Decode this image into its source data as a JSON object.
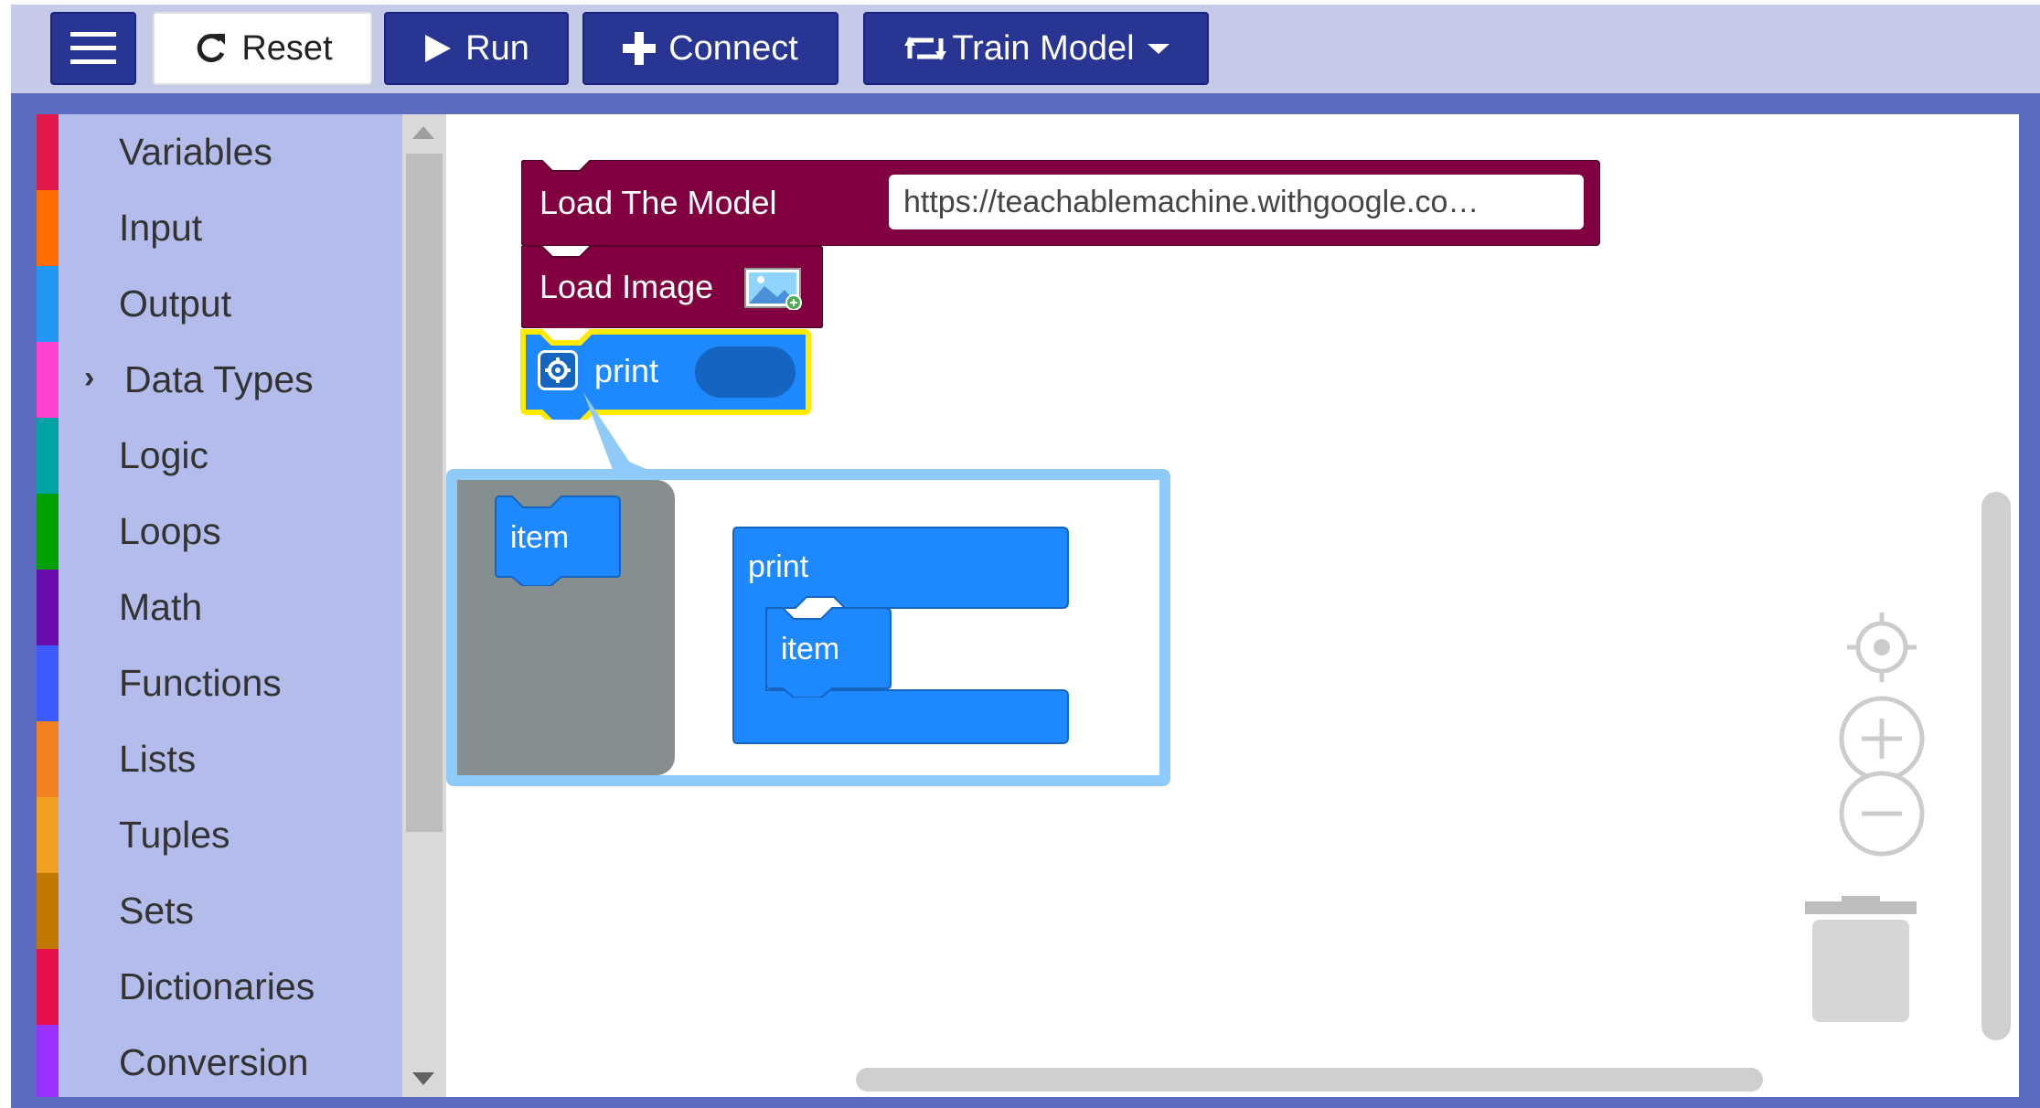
{
  "toolbar": {
    "reset_label": "Reset",
    "run_label": "Run",
    "connect_label": "Connect",
    "train_label": "Train Model"
  },
  "toolbox": {
    "categories": [
      {
        "label": "Variables",
        "color": "#e0194a"
      },
      {
        "label": "Input",
        "color": "#ff6d00"
      },
      {
        "label": "Output",
        "color": "#2196f3"
      },
      {
        "label": "Data Types",
        "color": "#ff40d0",
        "expandable": true
      },
      {
        "label": "Logic",
        "color": "#00a3a3"
      },
      {
        "label": "Loops",
        "color": "#00a000"
      },
      {
        "label": "Math",
        "color": "#6a0dad"
      },
      {
        "label": "Functions",
        "color": "#3d5afe"
      },
      {
        "label": "Lists",
        "color": "#f08020"
      },
      {
        "label": "Tuples",
        "color": "#f0a020"
      },
      {
        "label": "Sets",
        "color": "#c07800"
      },
      {
        "label": "Dictionaries",
        "color": "#e8104a"
      },
      {
        "label": "Conversion",
        "color": "#9b30ff"
      }
    ]
  },
  "workspace": {
    "load_model_label": "Load The Model",
    "model_url": "https://teachablemachine.withgoogle.co…",
    "load_image_label": "Load Image",
    "print_label": "print",
    "mutator": {
      "flyout_item_label": "item",
      "container_label": "print",
      "inner_item_label": "item"
    }
  },
  "colors": {
    "model_block": "#800040",
    "print_block": "#1e88ff",
    "selected_outline": "#ffea00",
    "toolbar_dark": "#283593",
    "frame": "#5c6bc0"
  }
}
